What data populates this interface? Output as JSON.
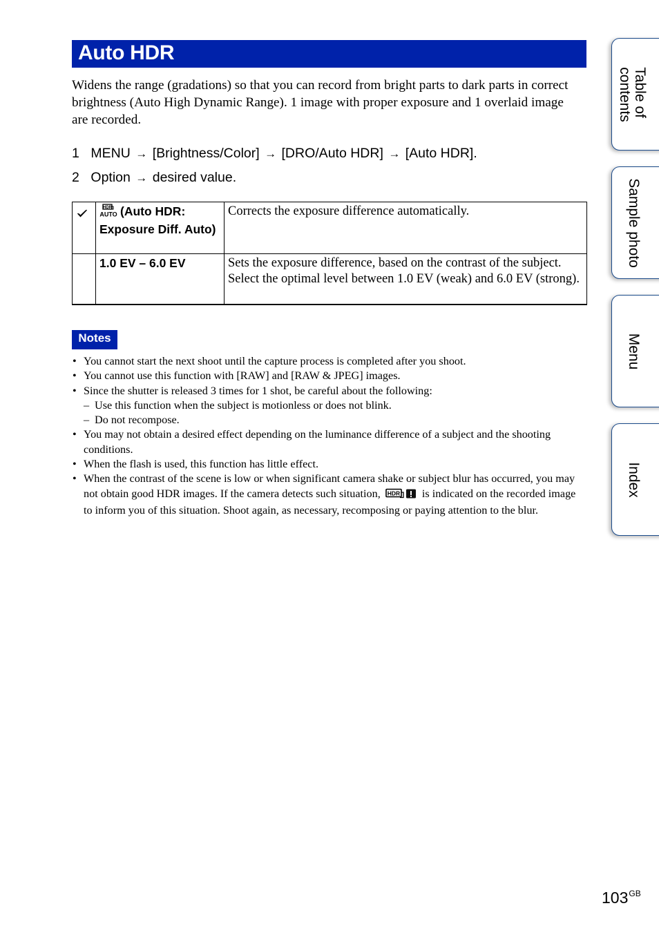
{
  "header": {
    "title": "Auto HDR",
    "accent_color": "#0022aa"
  },
  "intro": "Widens the range (gradations) so that you can record from bright parts to dark parts in correct brightness (Auto High Dynamic Range). 1 image with proper exposure and 1 overlaid image are recorded.",
  "steps": [
    {
      "number": "1",
      "parts": [
        "MENU",
        "[Brightness/Color]",
        "[DRO/Auto HDR]",
        "[Auto HDR]."
      ]
    },
    {
      "number": "2",
      "parts": [
        "Option",
        "desired value."
      ]
    }
  ],
  "arrow_glyph": "→",
  "options_table": {
    "rows": [
      {
        "default": true,
        "icon": "hdr-auto-icon",
        "name": "(Auto HDR: Exposure Diff. Auto)",
        "description": "Corrects the exposure difference automatically."
      },
      {
        "default": false,
        "icon": "",
        "name": "1.0 EV – 6.0 EV",
        "description": "Sets the exposure difference, based on the contrast of the subject. Select the optimal level between 1.0 EV (weak) and 6.0 EV (strong)."
      }
    ]
  },
  "notes": {
    "label": "Notes",
    "items": [
      {
        "type": "bullet",
        "text": "You cannot start the next shoot until the capture process is completed after you shoot."
      },
      {
        "type": "bullet",
        "text": "You cannot use this function with [RAW] and [RAW & JPEG] images."
      },
      {
        "type": "bullet",
        "text": "Since the shutter is released 3 times for 1 shot, be careful about the following:"
      },
      {
        "type": "sub",
        "text": "Use this function when the subject is motionless or does not blink."
      },
      {
        "type": "sub",
        "text": "Do not recompose."
      },
      {
        "type": "bullet",
        "text": "You may not obtain a desired effect depending on the luminance difference of a subject and the shooting conditions."
      },
      {
        "type": "bullet",
        "text": "When the flash is used, this function has little effect."
      },
      {
        "type": "bullet",
        "text_before": "When the contrast of the scene is low or when significant camera shake or subject blur has occurred, you may not obtain good HDR images. If the camera detects such situation,",
        "icon": "hdr-warning-icon",
        "text_after": "is indicated on the recorded image to inform you of this situation. Shoot again, as necessary, recomposing or paying attention to the blur."
      }
    ],
    "bullet_glyph": "•",
    "dash_glyph": "–"
  },
  "side_tabs": [
    {
      "label": "Table of\ncontents"
    },
    {
      "label": "Sample photo"
    },
    {
      "label": "Menu"
    },
    {
      "label": "Index"
    }
  ],
  "footer": {
    "page_number": "103",
    "page_suffix": "GB"
  }
}
